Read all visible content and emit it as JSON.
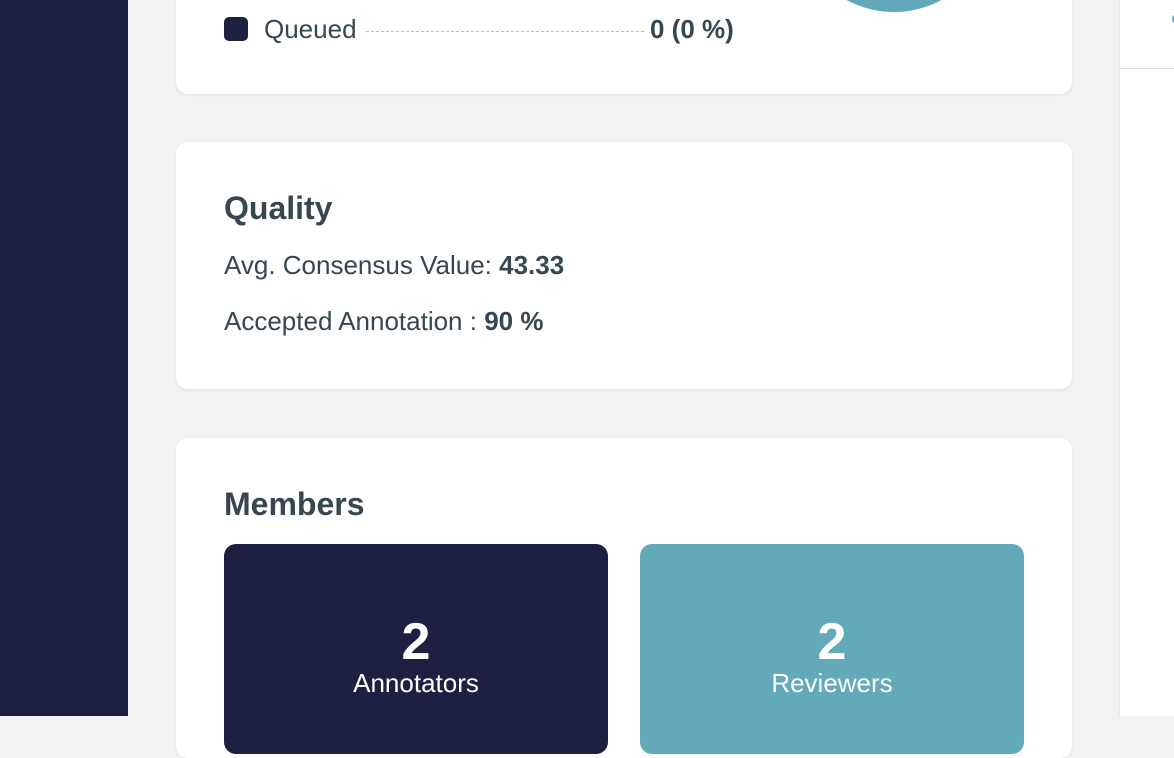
{
  "status_legend": {
    "items": [
      {
        "label": "Queued",
        "value": "0 (0 %)",
        "color": "#1e2042"
      }
    ],
    "pie_color": "#62a9b9"
  },
  "quality": {
    "title": "Quality",
    "avg_consensus_label": "Avg. Consensus Value:",
    "avg_consensus_value": "43.33",
    "accepted_label": "Accepted Annotation :",
    "accepted_value": "90 %"
  },
  "members": {
    "title": "Members",
    "annotators": {
      "count": "2",
      "label": "Annotators",
      "color": "#1e2042"
    },
    "reviewers": {
      "count": "2",
      "label": "Reviewers",
      "color": "#62a9b9"
    }
  },
  "theme": {
    "sidebar_color": "#1e2042",
    "background": "#f2f2f2",
    "text_color": "#37474f"
  }
}
